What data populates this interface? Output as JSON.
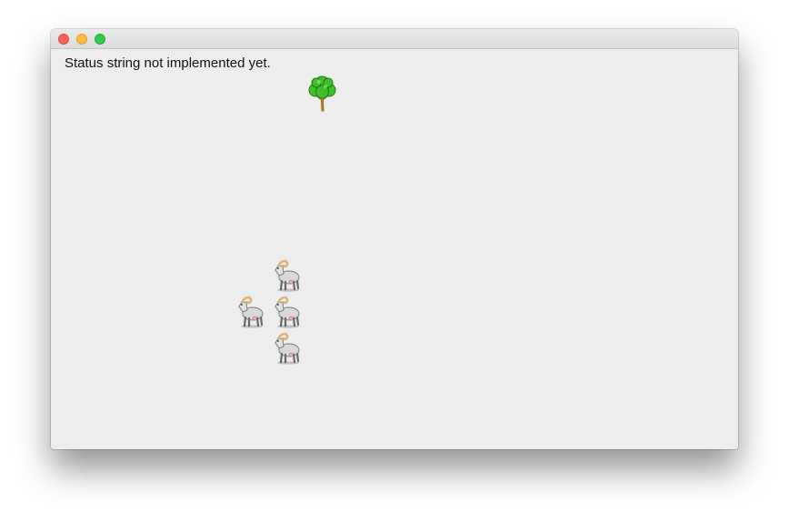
{
  "window": {
    "buttons": [
      "close",
      "minimize",
      "zoom"
    ]
  },
  "status": {
    "text": "Status string not implemented yet."
  },
  "sprites": {
    "tree": {
      "icon": "tree-icon"
    },
    "goats": [
      {
        "icon": "goat-icon"
      },
      {
        "icon": "goat-icon"
      },
      {
        "icon": "goat-icon"
      },
      {
        "icon": "goat-icon"
      }
    ]
  },
  "colors": {
    "background": "#ededed",
    "tree_leaves": "#3fbf2c",
    "tree_trunk": "#c98a1b",
    "goat_body": "#d9d9d9",
    "goat_horns": "#d8b27a",
    "goat_udder": "#f2a6d8"
  }
}
